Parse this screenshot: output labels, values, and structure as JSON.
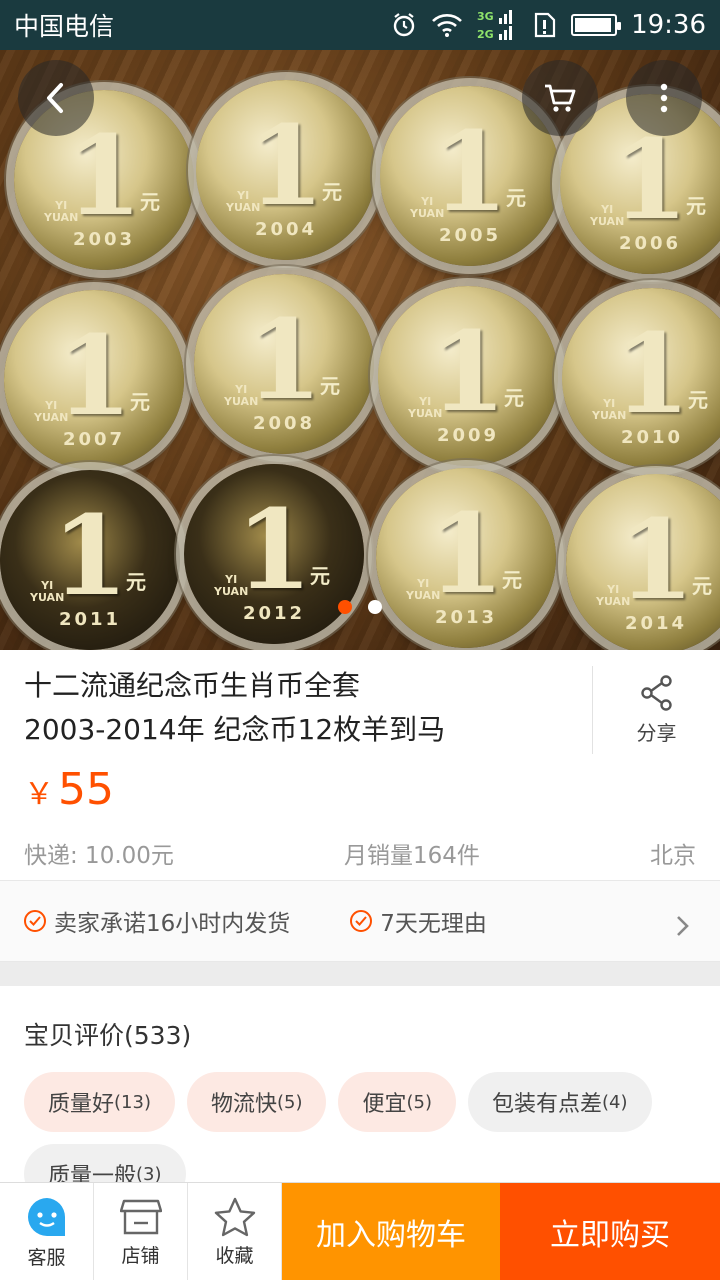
{
  "status_bar": {
    "carrier": "中国电信",
    "network": "3G 2G",
    "time": "19:36",
    "battery_level": 0.95
  },
  "gallery": {
    "active_index": 0,
    "total": 2,
    "coins": [
      {
        "value": "1",
        "unit": "元",
        "year": "2003"
      },
      {
        "value": "1",
        "unit": "元",
        "year": "2004"
      },
      {
        "value": "1",
        "unit": "元",
        "year": "2005"
      },
      {
        "value": "1",
        "unit": "元",
        "year": "2006"
      },
      {
        "value": "1",
        "unit": "元",
        "year": "2007"
      },
      {
        "value": "1",
        "unit": "元",
        "year": "2008"
      },
      {
        "value": "1",
        "unit": "元",
        "year": "2009"
      },
      {
        "value": "1",
        "unit": "元",
        "year": "2010"
      },
      {
        "value": "1",
        "unit": "元",
        "year": "2011"
      },
      {
        "value": "1",
        "unit": "元",
        "year": "2012"
      },
      {
        "value": "1",
        "unit": "元",
        "year": "2013"
      },
      {
        "value": "1",
        "unit": "元",
        "year": "2014"
      }
    ]
  },
  "product": {
    "title_line1": "十二流通纪念币生肖币全套",
    "title_line2": "2003-2014年 纪念币12枚羊到马",
    "share_label": "分享",
    "currency": "￥",
    "price": "55",
    "shipping": "快递: 10.00元",
    "monthly_sales": "月销量164件",
    "location": "北京"
  },
  "promises": [
    {
      "label": "卖家承诺16小时内发货"
    },
    {
      "label": "7天无理由"
    }
  ],
  "reviews": {
    "title": "宝贝评价(533)",
    "tags": [
      {
        "label": "质量好",
        "count": "(13)"
      },
      {
        "label": "物流快",
        "count": "(5)"
      },
      {
        "label": "便宜",
        "count": "(5)"
      },
      {
        "label": "包装有点差",
        "count": "(4)"
      },
      {
        "label": "质量一般",
        "count": "(3)"
      }
    ]
  },
  "bottom_bar": {
    "service_label": "客服",
    "store_label": "店铺",
    "favorite_label": "收藏",
    "add_to_cart_label": "加入购物车",
    "buy_now_label": "立即购买"
  },
  "colors": {
    "accent": "#ff5000",
    "cart": "#ff9400",
    "status_bar": "#1a3a3f"
  }
}
